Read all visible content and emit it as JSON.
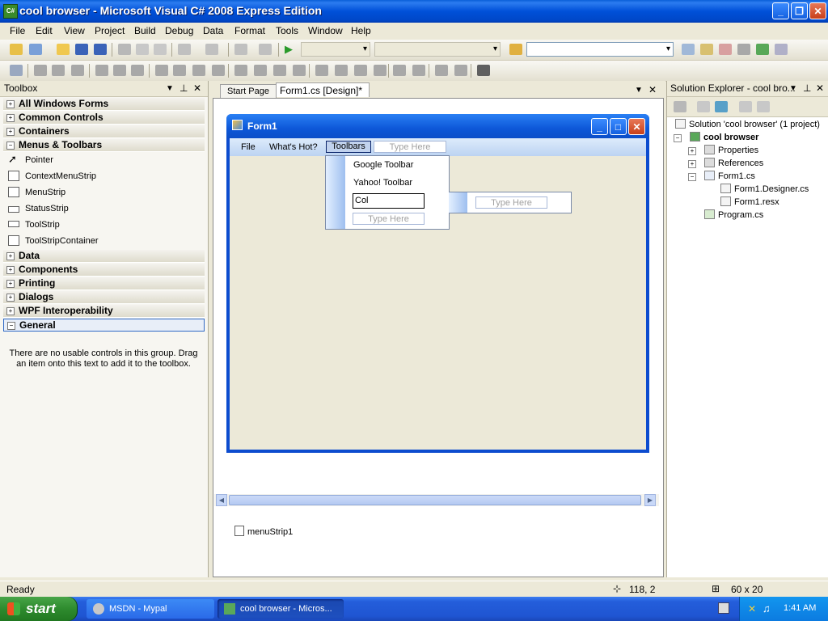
{
  "window": {
    "title": "cool browser - Microsoft Visual C# 2008 Express Edition"
  },
  "menubar": [
    "File",
    "Edit",
    "View",
    "Project",
    "Build",
    "Debug",
    "Data",
    "Format",
    "Tools",
    "Window",
    "Help"
  ],
  "toolbox": {
    "title": "Toolbox",
    "groups": [
      "All Windows Forms",
      "Common Controls",
      "Containers",
      "Menus & Toolbars"
    ],
    "menu_items": [
      "Pointer",
      "ContextMenuStrip",
      "MenuStrip",
      "StatusStrip",
      "ToolStrip",
      "ToolStripContainer"
    ],
    "groups_after": [
      "Data",
      "Components",
      "Printing",
      "Dialogs",
      "WPF Interoperability",
      "General"
    ],
    "empty_text": "There are no usable controls in this group. Drag an item onto this text to add it to the toolbox."
  },
  "tabs": {
    "start": "Start Page",
    "active": "Form1.cs [Design]*"
  },
  "form": {
    "title": "Form1",
    "menu": [
      "File",
      "What's Hot?",
      "Toolbars"
    ],
    "type_here": "Type Here",
    "dropdown_items": [
      "Google Toolbar",
      "Yahoo! Toolbar"
    ],
    "edit_value": "Col",
    "tray_component": "menuStrip1"
  },
  "solution_explorer": {
    "title": "Solution Explorer - cool bro...",
    "solution": "Solution 'cool browser' (1 project)",
    "project": "cool browser",
    "nodes": [
      "Properties",
      "References",
      "Form1.cs",
      "Form1.Designer.cs",
      "Form1.resx",
      "Program.cs"
    ]
  },
  "status": {
    "text": "Ready",
    "position": "118, 2",
    "size": "60 x 20"
  },
  "taskbar": {
    "start": "start",
    "tasks": [
      "MSDN - Mypal",
      "cool browser - Micros..."
    ],
    "clock": "1:41 AM"
  }
}
